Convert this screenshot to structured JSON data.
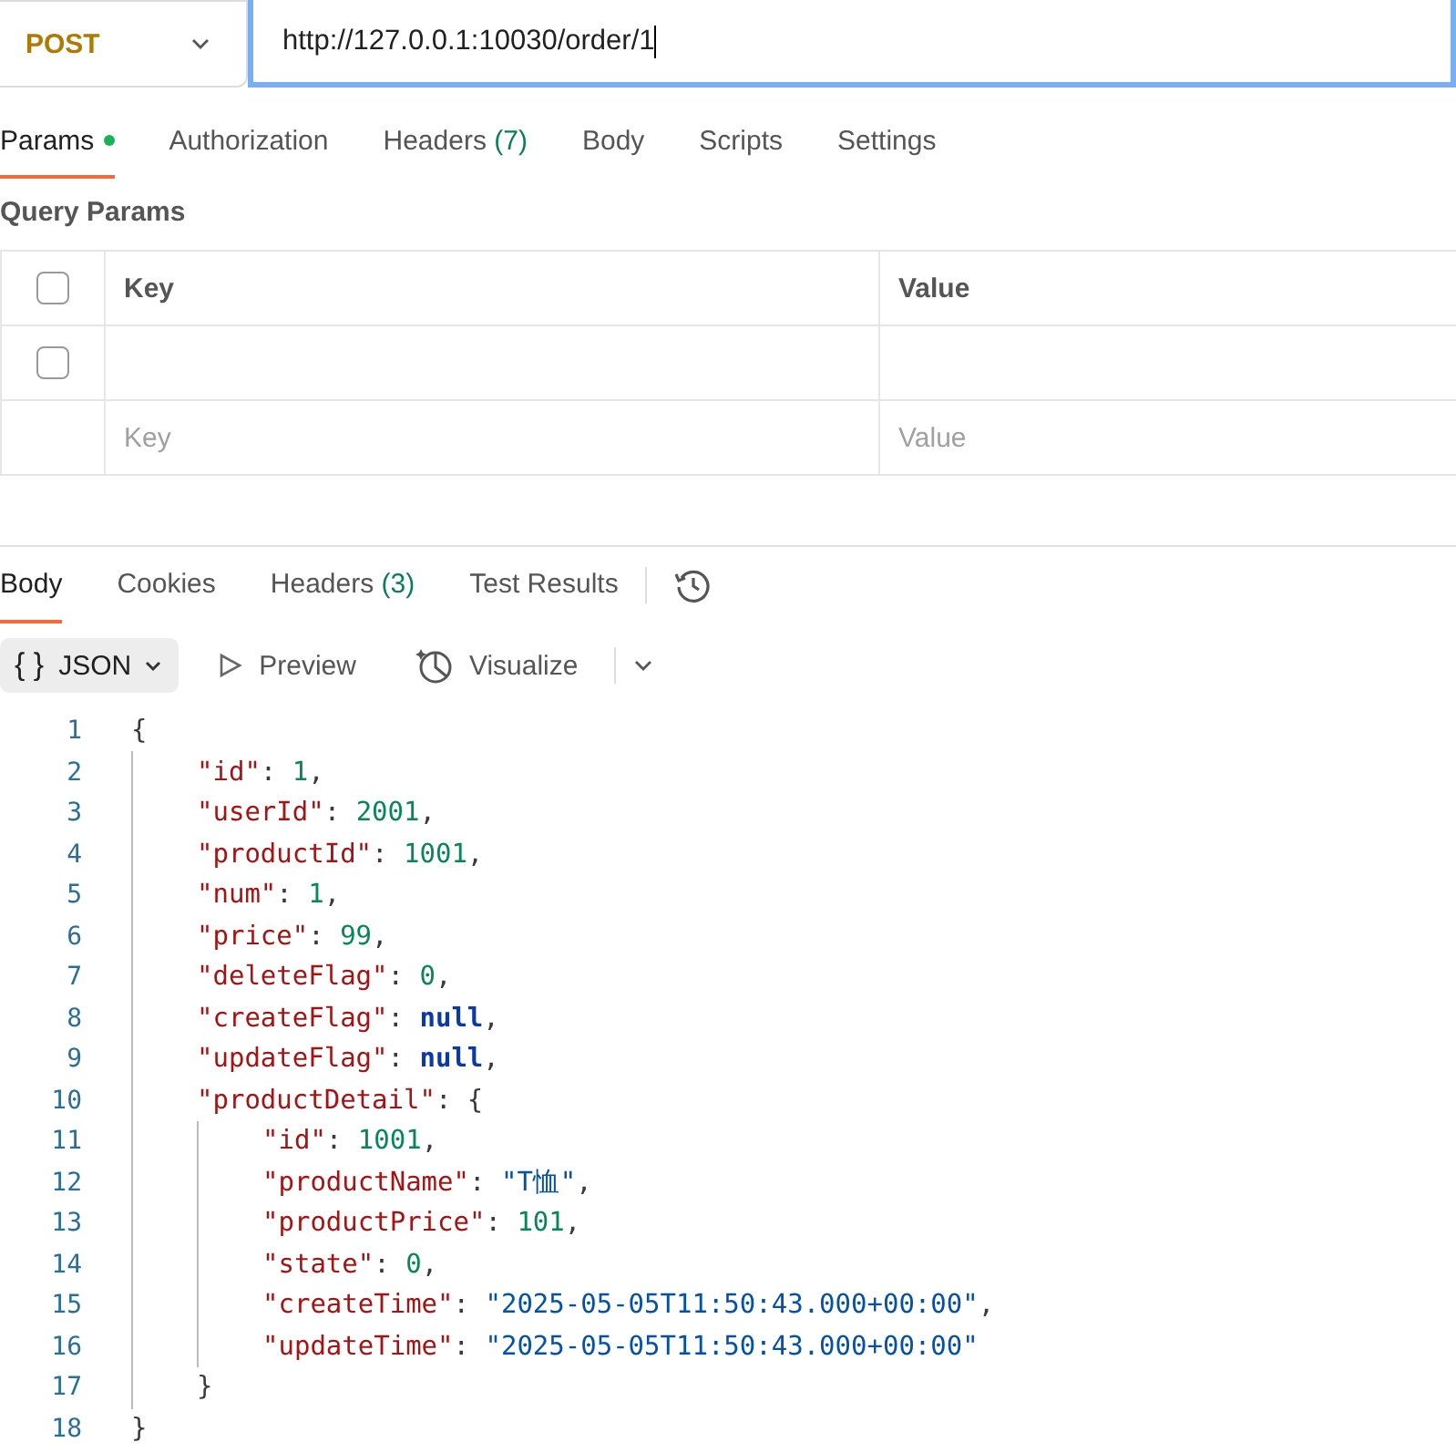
{
  "request": {
    "method": "POST",
    "url": "http://127.0.0.1:10030/order/1"
  },
  "request_tabs": [
    {
      "label": "Params",
      "selected": true,
      "dot": true
    },
    {
      "label": "Authorization",
      "selected": false
    },
    {
      "label": "Headers",
      "count": "(7)",
      "selected": false
    },
    {
      "label": "Body",
      "selected": false
    },
    {
      "label": "Scripts",
      "selected": false
    },
    {
      "label": "Settings",
      "selected": false
    }
  ],
  "query_params": {
    "title": "Query Params",
    "columns": [
      "Key",
      "Value"
    ],
    "header_checked": false,
    "rows": [
      {
        "checked": false
      }
    ],
    "new_row": {
      "key_placeholder": "Key",
      "value_placeholder": "Value"
    }
  },
  "response_tabs": [
    {
      "label": "Body",
      "selected": true
    },
    {
      "label": "Cookies",
      "selected": false
    },
    {
      "label": "Headers",
      "count": "(3)",
      "selected": false
    },
    {
      "label": "Test Results",
      "selected": false
    }
  ],
  "response_toolbar": {
    "format": {
      "icon": "{ }",
      "label": "JSON"
    },
    "preview": "Preview",
    "visualize": "Visualize"
  },
  "code": [
    {
      "number": "1",
      "tokens": [
        {
          "kind": "punct",
          "text": "{"
        }
      ],
      "children": [
        {
          "number": "2",
          "tokens": [
            {
              "kind": "key",
              "text": "\"id\""
            },
            {
              "kind": "punct",
              "text": ": "
            },
            {
              "kind": "number",
              "text": "1"
            },
            {
              "kind": "punct",
              "text": ","
            }
          ]
        },
        {
          "number": "3",
          "tokens": [
            {
              "kind": "key",
              "text": "\"userId\""
            },
            {
              "kind": "punct",
              "text": ": "
            },
            {
              "kind": "number",
              "text": "2001"
            },
            {
              "kind": "punct",
              "text": ","
            }
          ]
        },
        {
          "number": "4",
          "tokens": [
            {
              "kind": "key",
              "text": "\"productId\""
            },
            {
              "kind": "punct",
              "text": ": "
            },
            {
              "kind": "number",
              "text": "1001"
            },
            {
              "kind": "punct",
              "text": ","
            }
          ]
        },
        {
          "number": "5",
          "tokens": [
            {
              "kind": "key",
              "text": "\"num\""
            },
            {
              "kind": "punct",
              "text": ": "
            },
            {
              "kind": "number",
              "text": "1"
            },
            {
              "kind": "punct",
              "text": ","
            }
          ]
        },
        {
          "number": "6",
          "tokens": [
            {
              "kind": "key",
              "text": "\"price\""
            },
            {
              "kind": "punct",
              "text": ": "
            },
            {
              "kind": "number",
              "text": "99"
            },
            {
              "kind": "punct",
              "text": ","
            }
          ]
        },
        {
          "number": "7",
          "tokens": [
            {
              "kind": "key",
              "text": "\"deleteFlag\""
            },
            {
              "kind": "punct",
              "text": ": "
            },
            {
              "kind": "number",
              "text": "0"
            },
            {
              "kind": "punct",
              "text": ","
            }
          ]
        },
        {
          "number": "8",
          "tokens": [
            {
              "kind": "key",
              "text": "\"createFlag\""
            },
            {
              "kind": "punct",
              "text": ": "
            },
            {
              "kind": "null",
              "text": "null"
            },
            {
              "kind": "punct",
              "text": ","
            }
          ]
        },
        {
          "number": "9",
          "tokens": [
            {
              "kind": "key",
              "text": "\"updateFlag\""
            },
            {
              "kind": "punct",
              "text": ": "
            },
            {
              "kind": "null",
              "text": "null"
            },
            {
              "kind": "punct",
              "text": ","
            }
          ]
        },
        {
          "number": "10",
          "tokens": [
            {
              "kind": "key",
              "text": "\"productDetail\""
            },
            {
              "kind": "punct",
              "text": ": {"
            }
          ],
          "children": [
            {
              "number": "11",
              "tokens": [
                {
                  "kind": "key",
                  "text": "\"id\""
                },
                {
                  "kind": "punct",
                  "text": ": "
                },
                {
                  "kind": "number",
                  "text": "1001"
                },
                {
                  "kind": "punct",
                  "text": ","
                }
              ]
            },
            {
              "number": "12",
              "tokens": [
                {
                  "kind": "key",
                  "text": "\"productName\""
                },
                {
                  "kind": "punct",
                  "text": ": "
                },
                {
                  "kind": "string",
                  "text": "\"T恤\""
                },
                {
                  "kind": "punct",
                  "text": ","
                }
              ]
            },
            {
              "number": "13",
              "tokens": [
                {
                  "kind": "key",
                  "text": "\"productPrice\""
                },
                {
                  "kind": "punct",
                  "text": ": "
                },
                {
                  "kind": "number",
                  "text": "101"
                },
                {
                  "kind": "punct",
                  "text": ","
                }
              ]
            },
            {
              "number": "14",
              "tokens": [
                {
                  "kind": "key",
                  "text": "\"state\""
                },
                {
                  "kind": "punct",
                  "text": ": "
                },
                {
                  "kind": "number",
                  "text": "0"
                },
                {
                  "kind": "punct",
                  "text": ","
                }
              ]
            },
            {
              "number": "15",
              "tokens": [
                {
                  "kind": "key",
                  "text": "\"createTime\""
                },
                {
                  "kind": "punct",
                  "text": ": "
                },
                {
                  "kind": "string",
                  "text": "\"2025-05-05T11:50:43.000+00:00\""
                },
                {
                  "kind": "punct",
                  "text": ","
                }
              ]
            },
            {
              "number": "16",
              "tokens": [
                {
                  "kind": "key",
                  "text": "\"updateTime\""
                },
                {
                  "kind": "punct",
                  "text": ": "
                },
                {
                  "kind": "string",
                  "text": "\"2025-05-05T11:50:43.000+00:00\""
                }
              ]
            }
          ],
          "closing": {
            "number": "17",
            "text": "}"
          }
        }
      ],
      "closing": {
        "number": "18",
        "text": "}"
      }
    }
  ]
}
